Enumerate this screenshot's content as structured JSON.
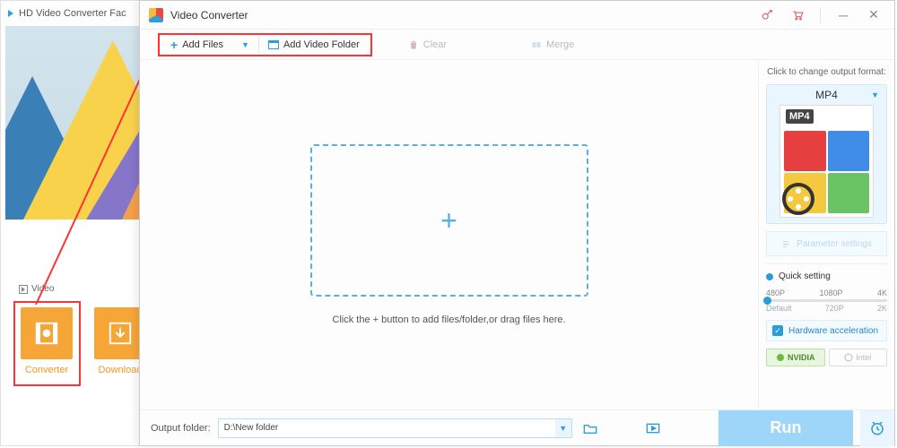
{
  "back": {
    "title": "HD Video Converter Fac",
    "video_bullet": "Video",
    "modules": [
      {
        "label": "Converter"
      },
      {
        "label": "Download"
      }
    ]
  },
  "front": {
    "title": "Video Converter",
    "toolbar": {
      "add_files": "Add Files",
      "add_folder": "Add Video Folder",
      "clear": "Clear",
      "merge": "Merge"
    },
    "drop_hint": "Click the + button to add files/folder,or drag files here.",
    "side": {
      "change_hint": "Click to change output format:",
      "format": "MP4",
      "format_tag": "MP4",
      "param_btn": "Parameter settings",
      "quick_setting": "Quick setting",
      "resolutions_top": [
        "480P",
        "1080P",
        "4K"
      ],
      "resolutions_bottom": [
        "Default",
        "720P",
        "2K"
      ],
      "hw_accel": "Hardware acceleration",
      "gpu_nvidia": "NVIDIA",
      "gpu_intel": "Intel"
    },
    "bottom": {
      "output_label": "Output folder:",
      "output_path": "D:\\New folder",
      "run": "Run"
    }
  }
}
